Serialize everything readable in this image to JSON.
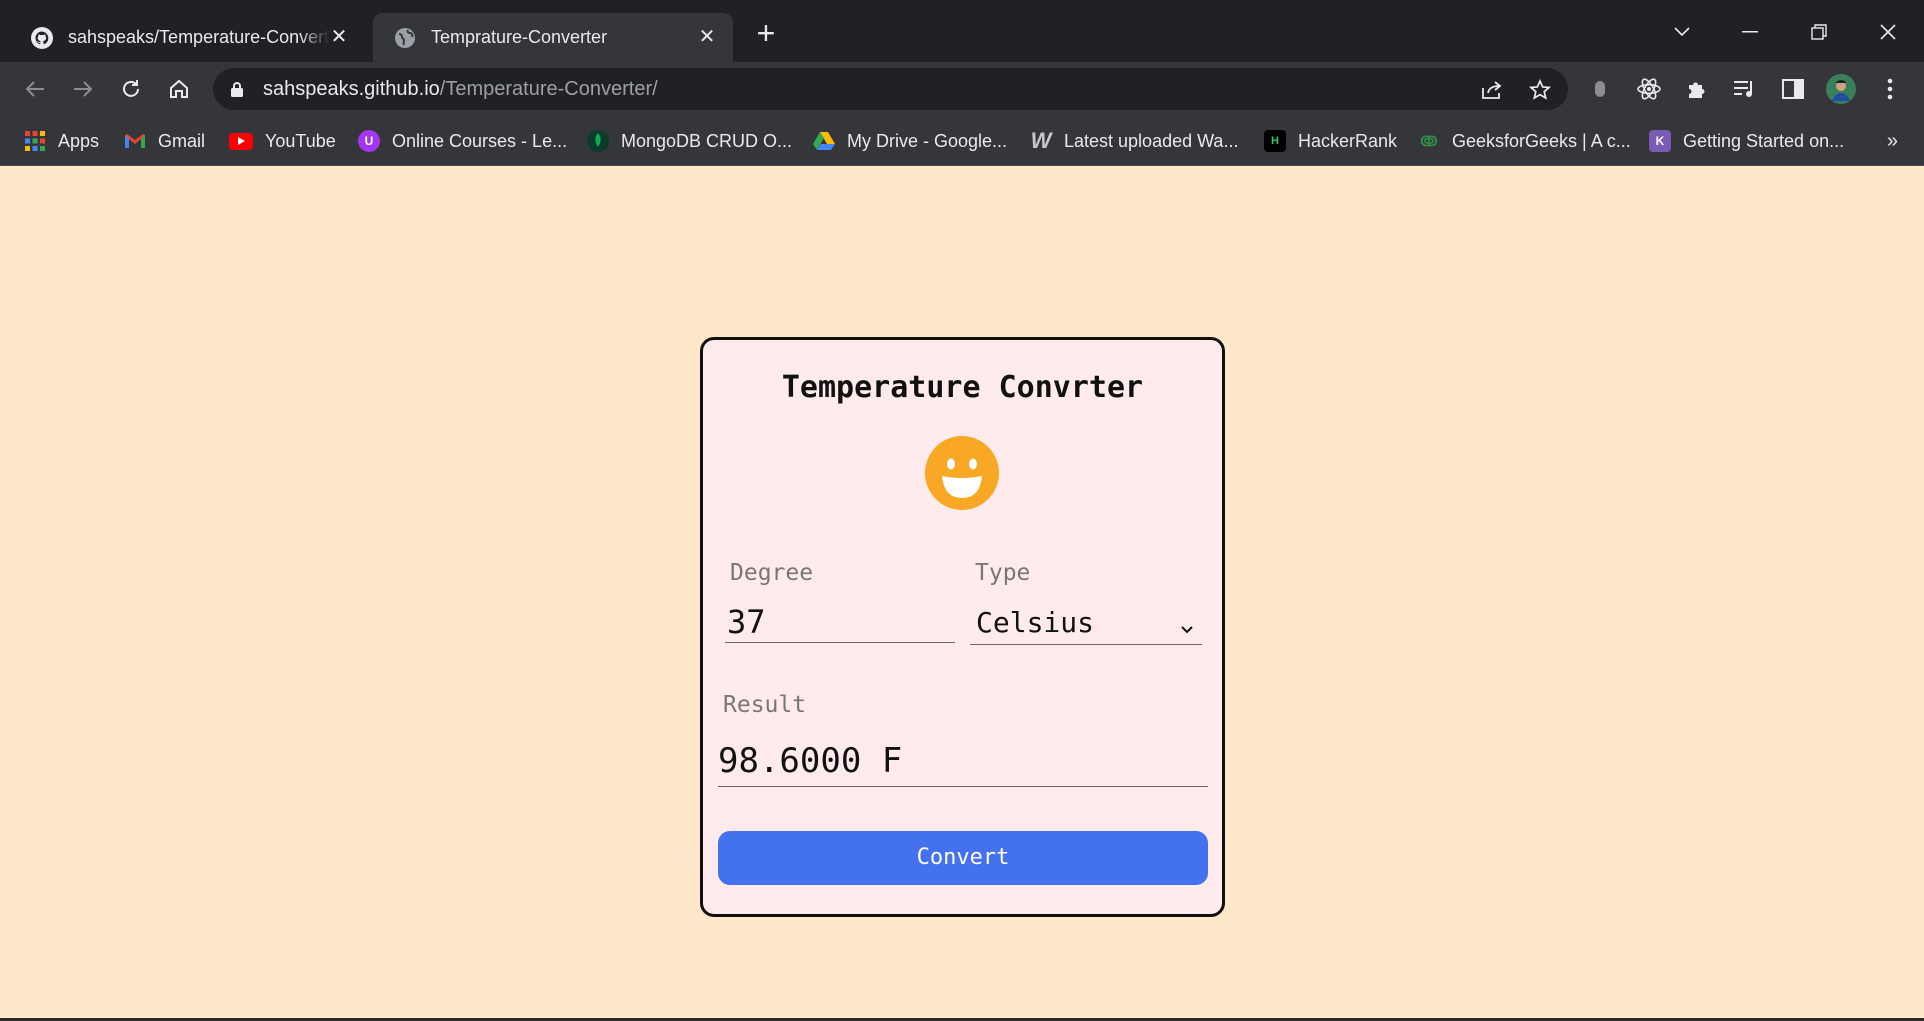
{
  "browser": {
    "tabs": [
      {
        "title": "sahspeaks/Temperature-Converter",
        "favicon": "github-icon",
        "active": false
      },
      {
        "title": "Temprature-Converter",
        "favicon": "globe-icon",
        "active": true
      }
    ],
    "url_host": "sahspeaks.github.io",
    "url_path": "/Temperature-Converter/",
    "bookmarks": [
      {
        "label": "Apps",
        "icon": "apps-grid-icon"
      },
      {
        "label": "Gmail",
        "icon": "gmail-icon"
      },
      {
        "label": "YouTube",
        "icon": "youtube-icon"
      },
      {
        "label": "Online Courses - Le...",
        "icon": "udemy-icon"
      },
      {
        "label": "MongoDB CRUD O...",
        "icon": "mongodb-icon"
      },
      {
        "label": "My Drive - Google...",
        "icon": "google-drive-icon"
      },
      {
        "label": "Latest uploaded Wa...",
        "icon": "w-icon"
      },
      {
        "label": "HackerRank",
        "icon": "hackerrank-icon"
      },
      {
        "label": "GeeksforGeeks | A c...",
        "icon": "geeksforgeeks-icon"
      },
      {
        "label": "Getting Started on...",
        "icon": "heroku-icon"
      }
    ],
    "bookmarks_overflow": "»"
  },
  "app": {
    "title": "Temperature Convrter",
    "emoji": "smiling-face-icon",
    "degree_label": "Degree",
    "degree_value": "37",
    "type_label": "Type",
    "type_value": "Celsius",
    "result_label": "Result",
    "result_value": "98.6000 F",
    "convert_label": "Convert"
  },
  "colors": {
    "page_bg": "#ffe7c9",
    "card_bg": "#ffebeb",
    "button": "#4471ee",
    "emoji": "#f9a825"
  }
}
